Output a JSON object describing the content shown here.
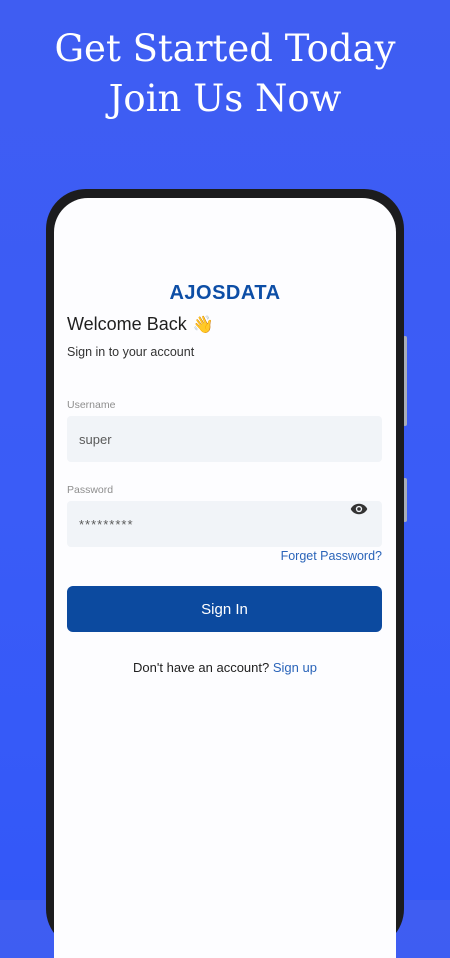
{
  "promo": {
    "line1": "Get Started Today",
    "line2": "Join Us Now"
  },
  "app": {
    "brand": "AJOSDATA",
    "welcome": "Welcome Back",
    "welcome_emoji": "👋",
    "subtitle": "Sign in to your account"
  },
  "form": {
    "username_label": "Username",
    "username_value": "super",
    "password_label": "Password",
    "password_value": "*********",
    "forgot_label": "Forget Password?",
    "signin_label": "Sign In",
    "signup_prompt": "Don't have an account?",
    "signup_link": "Sign up"
  },
  "icons": {
    "toggle_password": "eye-icon",
    "greeting": "waving-hand-icon"
  },
  "colors": {
    "background": "#3a5cf7",
    "brand": "#0d4ea6",
    "primary_button": "#0c4a9f",
    "link": "#2a64b9",
    "field_bg": "#f1f4f8"
  }
}
